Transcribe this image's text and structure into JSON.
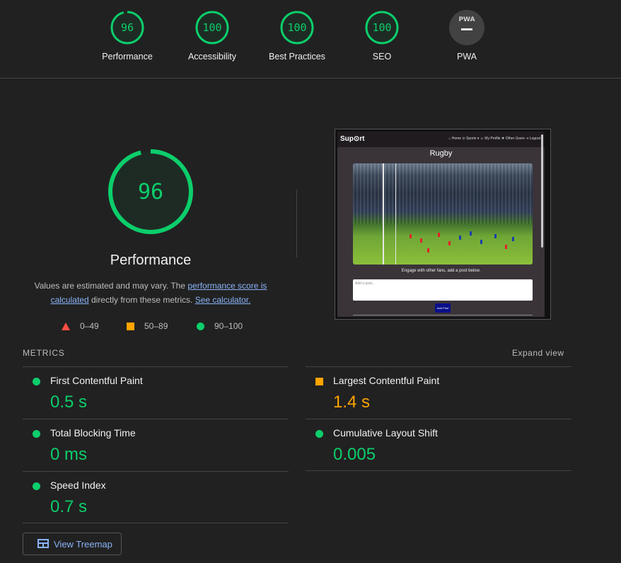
{
  "categories": [
    {
      "score": "96",
      "label": "Performance"
    },
    {
      "score": "100",
      "label": "Accessibility"
    },
    {
      "score": "100",
      "label": "Best Practices"
    },
    {
      "score": "100",
      "label": "SEO"
    },
    {
      "badge": "PWA",
      "label": "PWA"
    }
  ],
  "colors": {
    "pass": "#0cce6b",
    "average": "#ffa400",
    "fail": "#ff4e42",
    "link": "#8ab4f8"
  },
  "performance": {
    "score": "96",
    "score_fraction": 0.96,
    "title": "Performance",
    "desc_prefix": "Values are estimated and may vary. The ",
    "desc_link1": "performance score is calculated",
    "desc_middle": " directly from these metrics. ",
    "desc_link2": "See calculator."
  },
  "legend": [
    {
      "icon": "triangle-icon",
      "range": "0–49"
    },
    {
      "icon": "square-icon",
      "range": "50–89"
    },
    {
      "icon": "circle-icon",
      "range": "90–100"
    }
  ],
  "preview": {
    "brand": "Sup⊙rt",
    "nav": "⌂ Home  ⊙ Sports ▾  ☺ My Profile  ❖ Other Users  ⇥ Logout",
    "title": "Rugby",
    "engage": "Engage with other fans, add a post below.",
    "placeholder": "Add a post...",
    "button": "Add Post"
  },
  "metrics_heading": "METRICS",
  "expand_label": "Expand view",
  "metrics": [
    {
      "name": "First Contentful Paint",
      "value": "0.5 s",
      "rating": "pass"
    },
    {
      "name": "Largest Contentful Paint",
      "value": "1.4 s",
      "rating": "average"
    },
    {
      "name": "Total Blocking Time",
      "value": "0 ms",
      "rating": "pass"
    },
    {
      "name": "Cumulative Layout Shift",
      "value": "0.005",
      "rating": "pass"
    },
    {
      "name": "Speed Index",
      "value": "0.7 s",
      "rating": "pass"
    }
  ],
  "treemap_label": "View Treemap"
}
